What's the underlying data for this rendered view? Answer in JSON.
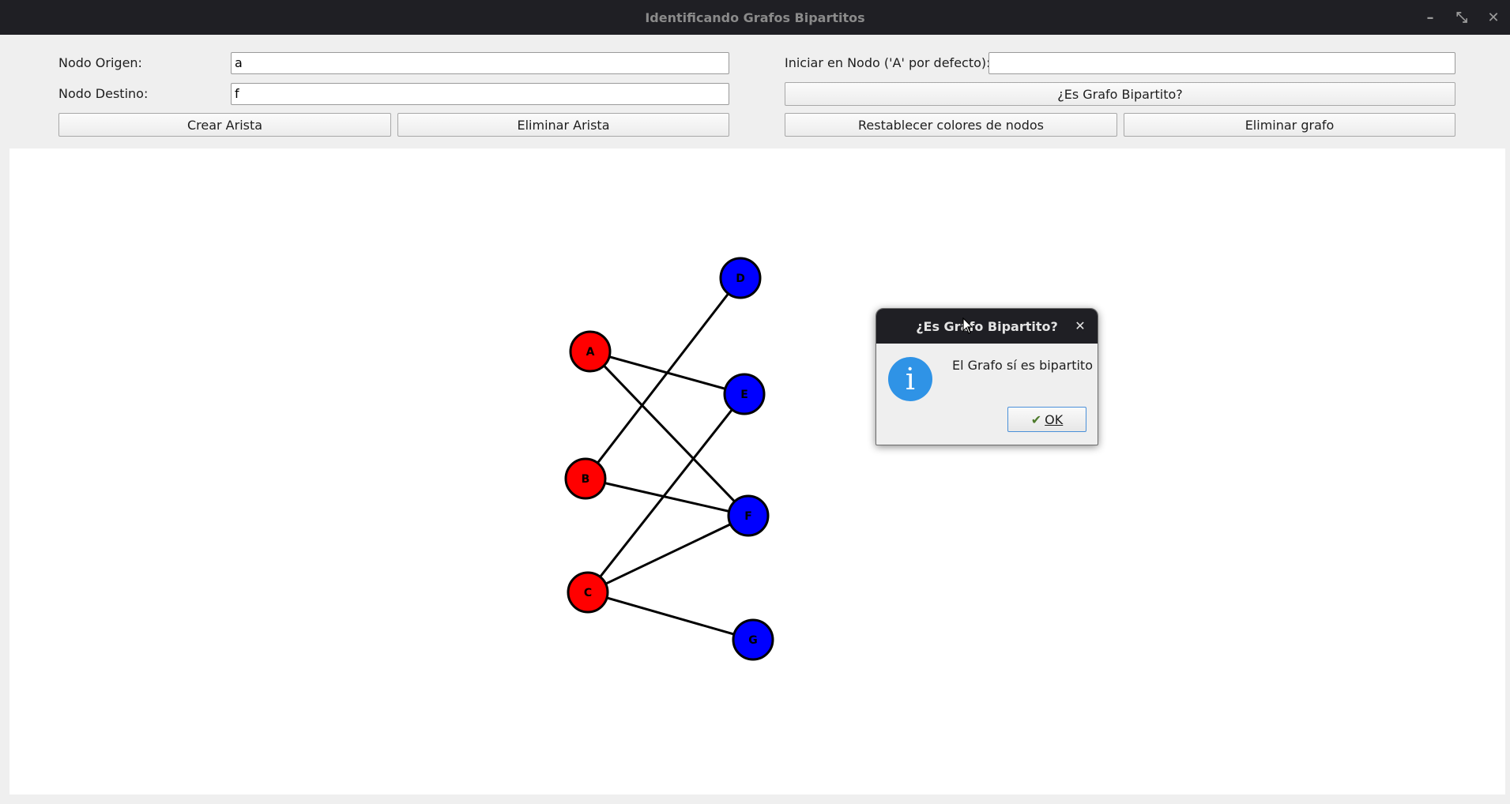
{
  "window": {
    "title": "Identificando Grafos Bipartitos",
    "controls": [
      {
        "name": "minimize-icon",
        "glyph": "–"
      },
      {
        "name": "restore-icon",
        "glyph": "⤡"
      },
      {
        "name": "close-icon",
        "glyph": "✕"
      }
    ]
  },
  "form": {
    "origin_label": "Nodo Origen:",
    "origin_value": "a",
    "dest_label": "Nodo Destino:",
    "dest_value": "f",
    "start_label": "Iniciar en Nodo ('A' por defecto):",
    "start_value": "",
    "create_edge": "Crear Arista",
    "delete_edge": "Eliminar Arista",
    "check_bipartite": "¿Es Grafo Bipartito?",
    "reset_colors": "Restablecer colores de nodos",
    "delete_graph": "Eliminar grafo"
  },
  "graph": {
    "colors": {
      "red": "#ff0000",
      "blue": "#0000ff",
      "stroke": "#000000"
    },
    "nodes": [
      {
        "id": "D",
        "color": "blue"
      },
      {
        "id": "A",
        "color": "red"
      },
      {
        "id": "E",
        "color": "blue"
      },
      {
        "id": "B",
        "color": "red"
      },
      {
        "id": "F",
        "color": "blue"
      },
      {
        "id": "C",
        "color": "red"
      },
      {
        "id": "G",
        "color": "blue"
      }
    ],
    "edges": [
      [
        "A",
        "E"
      ],
      [
        "A",
        "F"
      ],
      [
        "B",
        "D"
      ],
      [
        "B",
        "F"
      ],
      [
        "C",
        "E"
      ],
      [
        "C",
        "F"
      ],
      [
        "C",
        "G"
      ]
    ]
  },
  "dialog": {
    "title": "¿Es Grafo Bipartito?",
    "message": "El Grafo sí es bipartito",
    "ok": "OK",
    "icon": "info-icon",
    "close_glyph": "✕",
    "info_glyph": "i",
    "check_glyph": "✔"
  }
}
